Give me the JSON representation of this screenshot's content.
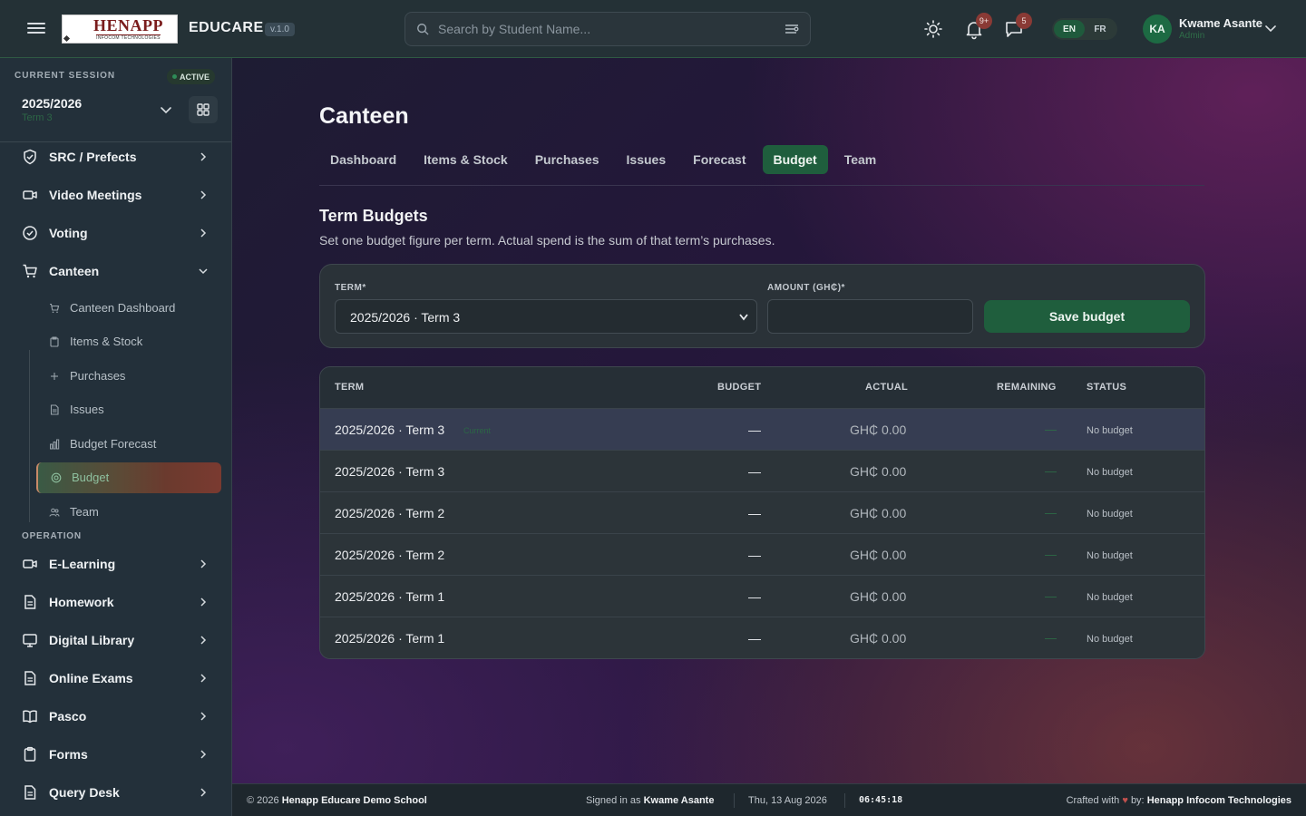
{
  "header": {
    "logo_main": "HENAPP",
    "logo_sub": "INFOCOM TECHNOLOGIES",
    "brand": "EDUCARE",
    "version": "v.1.0",
    "search_placeholder": "Search by Student Name...",
    "notification_badge": "9+",
    "messages_badge": "5",
    "lang_en": "EN",
    "lang_fr": "FR",
    "avatar_initials": "KA",
    "user_name": "Kwame Asante",
    "user_role": "Admin",
    "icons": [
      "menu-icon",
      "search-icon",
      "filter-icon",
      "sun-icon",
      "bell-icon",
      "chat-icon",
      "chevron-down-icon"
    ]
  },
  "sidebar": {
    "session_label": "CURRENT SESSION",
    "active_label": "ACTIVE",
    "session_year": "2025/2026",
    "session_term": "Term 3",
    "items_top": [
      {
        "label": "SRC / Prefects",
        "icon": "shield-icon"
      },
      {
        "label": "Video Meetings",
        "icon": "video-icon"
      },
      {
        "label": "Voting",
        "icon": "check-circle-icon"
      },
      {
        "label": "Canteen",
        "icon": "cart-icon"
      }
    ],
    "canteen_sub": [
      {
        "label": "Canteen Dashboard",
        "icon": "cart-icon"
      },
      {
        "label": "Items & Stock",
        "icon": "clipboard-icon"
      },
      {
        "label": "Purchases",
        "icon": "plus-icon"
      },
      {
        "label": "Issues",
        "icon": "document-icon"
      },
      {
        "label": "Budget Forecast",
        "icon": "bar-chart-icon"
      },
      {
        "label": "Budget",
        "icon": "target-icon"
      },
      {
        "label": "Team",
        "icon": "users-icon"
      }
    ],
    "section_operation": "OPERATION",
    "items_operation": [
      {
        "label": "E-Learning",
        "icon": "video-icon"
      },
      {
        "label": "Homework",
        "icon": "document-icon"
      },
      {
        "label": "Digital Library",
        "icon": "monitor-icon"
      },
      {
        "label": "Online Exams",
        "icon": "document-icon"
      },
      {
        "label": "Pasco",
        "icon": "book-icon"
      },
      {
        "label": "Forms",
        "icon": "clipboard-icon"
      },
      {
        "label": "Query Desk",
        "icon": "document-icon"
      }
    ]
  },
  "main": {
    "title": "Canteen",
    "tabs": [
      "Dashboard",
      "Items & Stock",
      "Purchases",
      "Issues",
      "Forecast",
      "Budget",
      "Team"
    ],
    "active_tab": "Budget",
    "section_title": "Term Budgets",
    "section_desc": "Set one budget figure per term. Actual spend is the sum of that term’s purchases.",
    "form": {
      "term_label": "TERM*",
      "term_value": "2025/2026 · Term 3",
      "amount_label": "AMOUNT (GH₵)*",
      "amount_value": "",
      "save_label": "Save budget"
    },
    "table": {
      "headers": [
        "TERM",
        "BUDGET",
        "ACTUAL",
        "REMAINING",
        "STATUS"
      ],
      "current_tag": "Current",
      "rows": [
        {
          "term": "2025/2026 · Term 3",
          "budget": "—",
          "actual": "GH₵ 0.00",
          "remaining": "—",
          "status": "No budget"
        },
        {
          "term": "2025/2026 · Term 3",
          "budget": "—",
          "actual": "GH₵ 0.00",
          "remaining": "—",
          "status": "No budget"
        },
        {
          "term": "2025/2026 · Term 2",
          "budget": "—",
          "actual": "GH₵ 0.00",
          "remaining": "—",
          "status": "No budget"
        },
        {
          "term": "2025/2026 · Term 2",
          "budget": "—",
          "actual": "GH₵ 0.00",
          "remaining": "—",
          "status": "No budget"
        },
        {
          "term": "2025/2026 · Term 1",
          "budget": "—",
          "actual": "GH₵ 0.00",
          "remaining": "—",
          "status": "No budget"
        },
        {
          "term": "2025/2026 · Term 1",
          "budget": "—",
          "actual": "GH₵ 0.00",
          "remaining": "—",
          "status": "No budget"
        }
      ]
    }
  },
  "footer": {
    "copyright_prefix": "© 2026",
    "school": "Henapp Educare Demo School",
    "signed_prefix": "Signed in as",
    "signed_user": "Kwame Asante",
    "date": "Thu, 13 Aug 2026",
    "time": "06:45:18",
    "crafted_prefix": "Crafted with",
    "crafted_by": "by:",
    "company": "Henapp Infocom Technologies"
  },
  "colors": {
    "accent_green": "#1f5e3d",
    "sidebar_bg": "#23303a",
    "topbar_bg": "#243136",
    "badge_red": "#8a3a35"
  }
}
